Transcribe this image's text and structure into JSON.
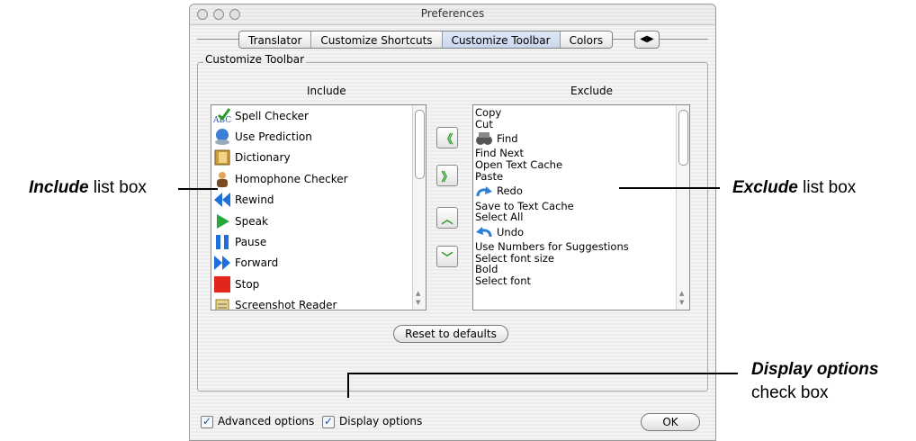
{
  "window": {
    "title": "Preferences",
    "tabs": [
      "Translator",
      "Customize Shortcuts",
      "Customize Toolbar",
      "Colors"
    ],
    "selected_tab": "Customize Toolbar",
    "tab_scroll_glyph": "◀▶"
  },
  "group": {
    "label": "Customize Toolbar",
    "include_header": "Include",
    "exclude_header": "Exclude"
  },
  "include_items": [
    {
      "label": "Spell Checker",
      "icon": "spell-checker-icon"
    },
    {
      "label": "Use Prediction",
      "icon": "prediction-globe-icon"
    },
    {
      "label": "Dictionary",
      "icon": "dictionary-book-icon"
    },
    {
      "label": "Homophone Checker",
      "icon": "homophone-person-icon"
    },
    {
      "label": "Rewind",
      "icon": "rewind-icon"
    },
    {
      "label": "Speak",
      "icon": "speak-play-icon"
    },
    {
      "label": "Pause",
      "icon": "pause-icon"
    },
    {
      "label": "Forward",
      "icon": "forward-icon"
    },
    {
      "label": "Stop",
      "icon": "stop-icon"
    },
    {
      "label": "Screenshot Reader",
      "icon": "screenshot-reader-icon"
    }
  ],
  "exclude_items": [
    {
      "label": "Copy",
      "icon": null
    },
    {
      "label": "Cut",
      "icon": null
    },
    {
      "label": "Find",
      "icon": "find-binoculars-icon"
    },
    {
      "label": "Find Next",
      "icon": null
    },
    {
      "label": "Open Text Cache",
      "icon": null
    },
    {
      "label": "Paste",
      "icon": null
    },
    {
      "label": "Redo",
      "icon": "redo-arrow-icon"
    },
    {
      "label": "Save to Text Cache",
      "icon": null
    },
    {
      "label": "Select All",
      "icon": null
    },
    {
      "label": "Undo",
      "icon": "undo-arrow-icon"
    },
    {
      "label": "Use Numbers for Suggestions",
      "icon": null
    },
    {
      "label": "Select font size",
      "icon": null
    },
    {
      "label": "Bold",
      "icon": null
    },
    {
      "label": "Select font",
      "icon": null
    }
  ],
  "move_buttons": {
    "to_include": "《",
    "to_exclude": "》",
    "move_up": "︿",
    "move_down": "﹀"
  },
  "reset_button": "Reset to defaults",
  "ok_button": "OK",
  "checkboxes": {
    "advanced": {
      "label": "Advanced options",
      "checked": true
    },
    "display": {
      "label": "Display options",
      "checked": true
    }
  },
  "callouts": {
    "include": {
      "bold": "Include",
      "rest": " list box"
    },
    "exclude": {
      "bold": "Exclude",
      "rest": " list box"
    },
    "display": {
      "bold": "Display options",
      "rest": "check box"
    }
  },
  "colors": {
    "accent_green": "#2a9a2a",
    "checkbox_blue": "#1f4fa8"
  }
}
